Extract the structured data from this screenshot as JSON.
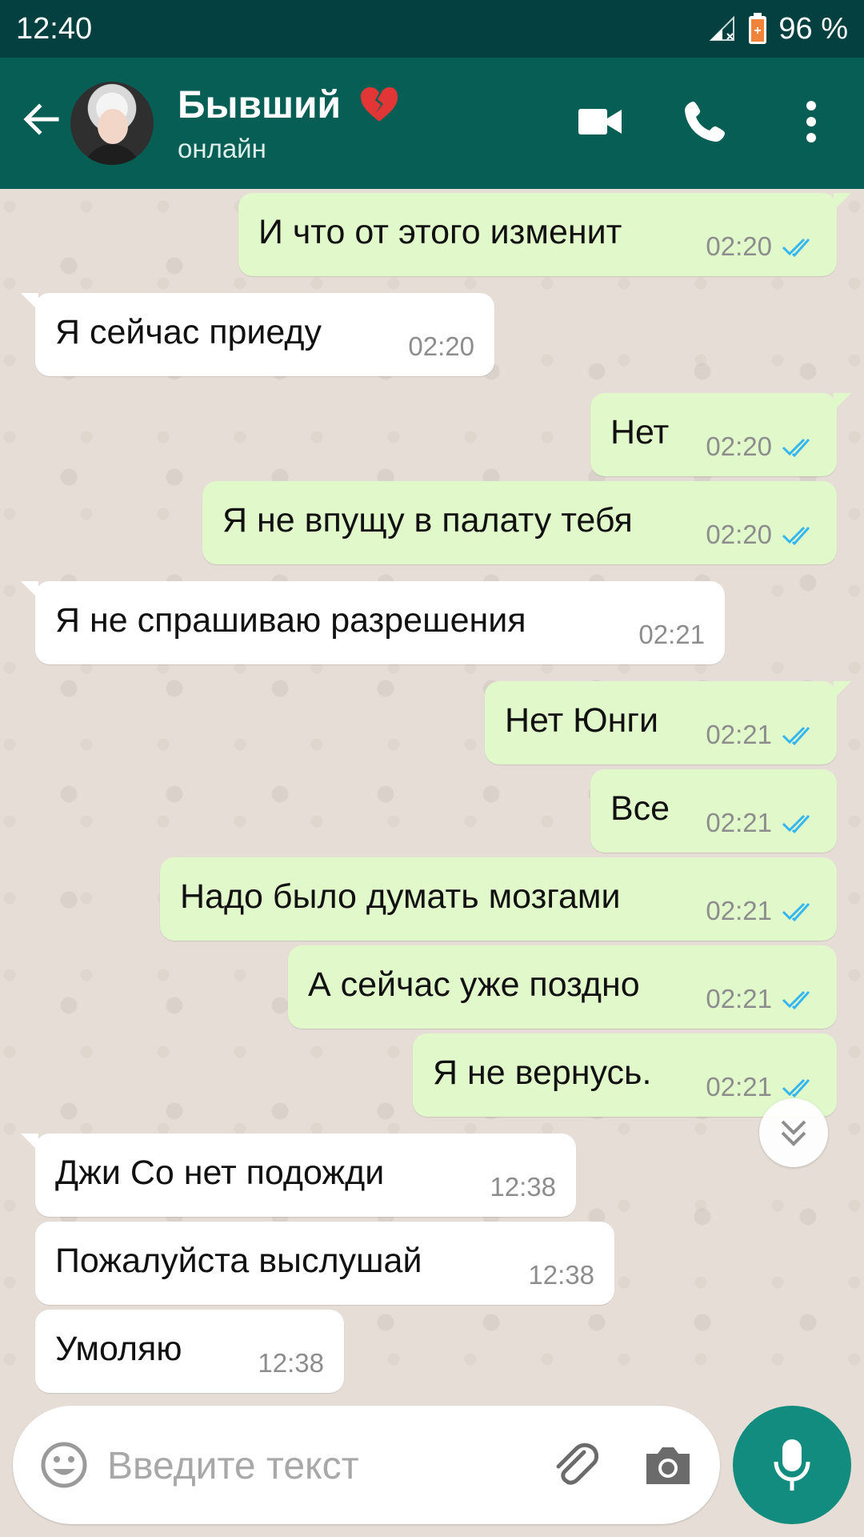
{
  "status_bar": {
    "time": "12:40",
    "battery": "96 %"
  },
  "header": {
    "contact_name": "Бывший",
    "status": "онлайн"
  },
  "messages": [
    {
      "dir": "out",
      "text": "И что от этого изменит",
      "time": "02:20"
    },
    {
      "dir": "in",
      "text": "Я сейчас приеду",
      "time": "02:20"
    },
    {
      "dir": "out",
      "text": "Нет",
      "time": "02:20"
    },
    {
      "dir": "out",
      "text": "Я не впущу в палату тебя",
      "time": "02:20"
    },
    {
      "dir": "in",
      "text": "Я не спрашиваю разрешения",
      "time": "02:21"
    },
    {
      "dir": "out",
      "text": "Нет Юнги",
      "time": "02:21"
    },
    {
      "dir": "out",
      "text": "Все",
      "time": "02:21"
    },
    {
      "dir": "out",
      "text": "Надо было думать мозгами",
      "time": "02:21"
    },
    {
      "dir": "out",
      "text": "А сейчас уже поздно",
      "time": "02:21"
    },
    {
      "dir": "out",
      "text": "Я не вернусь.",
      "time": "02:21"
    },
    {
      "dir": "in",
      "text": "Джи Со нет подожди",
      "time": "12:38"
    },
    {
      "dir": "in",
      "text": "Пожалуйста выслушай",
      "time": "12:38"
    },
    {
      "dir": "in",
      "text": "Умоляю",
      "time": "12:38"
    }
  ],
  "composer": {
    "placeholder": "Введите текст"
  },
  "colors": {
    "status_bar": "#03403f",
    "header": "#075e54",
    "outgoing_bubble": "#e1f8cb",
    "incoming_bubble": "#ffffff",
    "read_ticks": "#34b7f1",
    "mic_button": "#128c7e"
  },
  "icons": {
    "back": "arrow-left-icon",
    "video": "video-camera-icon",
    "call": "phone-icon",
    "menu": "more-vertical-icon",
    "emoji": "emoji-icon",
    "attach": "paperclip-icon",
    "camera": "camera-icon",
    "mic": "microphone-icon",
    "scroll": "chevron-double-down-icon"
  }
}
